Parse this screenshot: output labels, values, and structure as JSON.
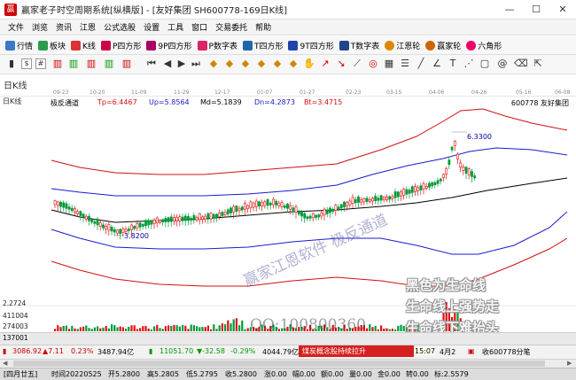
{
  "window": {
    "title": "赢家老子时空周期系统[纵横版] - [友好集团  SH600778-169日K线]",
    "minimize": "—",
    "maximize": "☐",
    "close": "✕"
  },
  "menu": [
    "文件",
    "浏览",
    "资讯",
    "江恩",
    "公式选股",
    "设置",
    "工具",
    "窗口",
    "交易委托",
    "帮助"
  ],
  "toolbar1": [
    "行情",
    "板块",
    "K线",
    "P四方形",
    "9P四方形",
    "P数字表",
    "T四方形",
    "9T四方形",
    "T数字表",
    "江恩轮",
    "赢家轮",
    "六角形"
  ],
  "ruler": {
    "label": "日K线",
    "dates": [
      "09-23",
      "10-20",
      "11-09",
      "11-29",
      "12-17",
      "01-07",
      "01-27",
      "02-23",
      "03-15",
      "04-06",
      "04-26",
      "05-16",
      "06-08"
    ]
  },
  "indicator": {
    "name": "极反通道",
    "tp": "Tp=6.4467",
    "up": "Up=5.8564",
    "md": "Md=5.1839",
    "dn": "Dn=4.2873",
    "bt": "Bt=3.4715"
  },
  "stock_label": "600778 友好集团",
  "high_label": "6.3300",
  "low_label": "3.8200",
  "volume_scale": [
    "2.2724",
    "411004",
    "274003",
    "137001"
  ],
  "watermarks": {
    "diag": "赢家江恩软件 极反通道",
    "qq": "QQ:100800360",
    "captions": [
      "黑色为生命线",
      "生命线上强势走",
      "生命线下难抬头"
    ]
  },
  "status": {
    "index1": "3086.92",
    "change1": "▲7.11",
    "pct1": "0.23%",
    "amt1": "3487.94亿",
    "index2": "11051.70",
    "change2": "▼-32.58",
    "pct2": "-0.29%",
    "amt2": "4044.79亿",
    "news": "煤炭概念股持续拉升",
    "time": "15:07",
    "date": "4月2",
    "extra": "收600778分笔"
  },
  "info": {
    "day": "[四月廿五]",
    "time": "时间20220525",
    "open": "开5.2800",
    "high": "高5.2805",
    "low": "低5.2795",
    "close": "收5.2800",
    "change": "涨0.00",
    "pct": "幅0.00",
    "amount": "额0.00",
    "volume": "量0.00",
    "money": "金0.00",
    "trd": "转0.00",
    "flag": "标:2.5579"
  },
  "colors": {
    "upper_channel": "#d01010",
    "lower_channel": "#1a1acc",
    "midline": "#000000",
    "candle_up": "#e01010",
    "candle_down": "#009a3a",
    "red_banner": "#d62020"
  }
}
